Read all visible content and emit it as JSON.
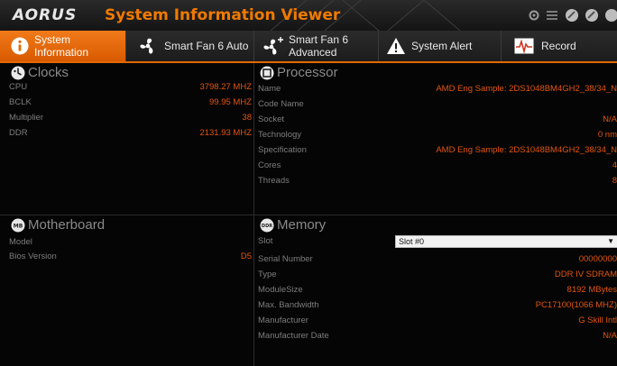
{
  "app": {
    "logo": "AORUS",
    "title": "System Information Viewer"
  },
  "tabs": [
    {
      "label": "System Information",
      "icon": "info-icon",
      "active": true
    },
    {
      "label": "Smart Fan 6 Auto",
      "icon": "fan-icon"
    },
    {
      "label": "Smart Fan 6 Advanced",
      "icon": "fan-advanced-icon"
    },
    {
      "label": "System Alert",
      "icon": "warning-icon"
    },
    {
      "label": "Record",
      "icon": "record-waveform-icon"
    }
  ],
  "clocks": {
    "title": "Clocks",
    "rows": [
      {
        "label": "CPU",
        "value": "3798.27 MHZ"
      },
      {
        "label": "BCLK",
        "value": "99.95 MHZ"
      },
      {
        "label": "Multiplier",
        "value": "38"
      },
      {
        "label": "DDR",
        "value": "2131.93 MHZ"
      }
    ]
  },
  "processor": {
    "title": "Processor",
    "rows": [
      {
        "label": "Name",
        "value": "AMD Eng Sample: 2DS1048BM4GH2_38/34_N"
      },
      {
        "label": "Code Name",
        "value": ""
      },
      {
        "label": "Socket",
        "value": "N/A"
      },
      {
        "label": "Technology",
        "value": "0 nm"
      },
      {
        "label": "Specification",
        "value": "AMD Eng Sample: 2DS1048BM4GH2_38/34_N"
      },
      {
        "label": "Cores",
        "value": "4"
      },
      {
        "label": "Threads",
        "value": "8"
      }
    ]
  },
  "motherboard": {
    "title": "Motherboard",
    "rows": [
      {
        "label": "Model",
        "value": ""
      },
      {
        "label": "Bios Version",
        "value": "D5"
      }
    ]
  },
  "memory": {
    "title": "Memory",
    "slot_label": "Slot",
    "slot_selected": "Slot #0",
    "rows": [
      {
        "label": "Serial Number",
        "value": "00000000"
      },
      {
        "label": "Type",
        "value": "DDR IV SDRAM"
      },
      {
        "label": "ModuleSize",
        "value": "8192 MBytes"
      },
      {
        "label": "Max. Bandwidth",
        "value": "PC17100(1066 MHZ)"
      },
      {
        "label": "Manufacturer",
        "value": "G Skill Intl"
      },
      {
        "label": "Manufacturer Date",
        "value": "N/A"
      }
    ]
  },
  "colors": {
    "accent": "#e06a00",
    "value_text": "#e2550e"
  }
}
